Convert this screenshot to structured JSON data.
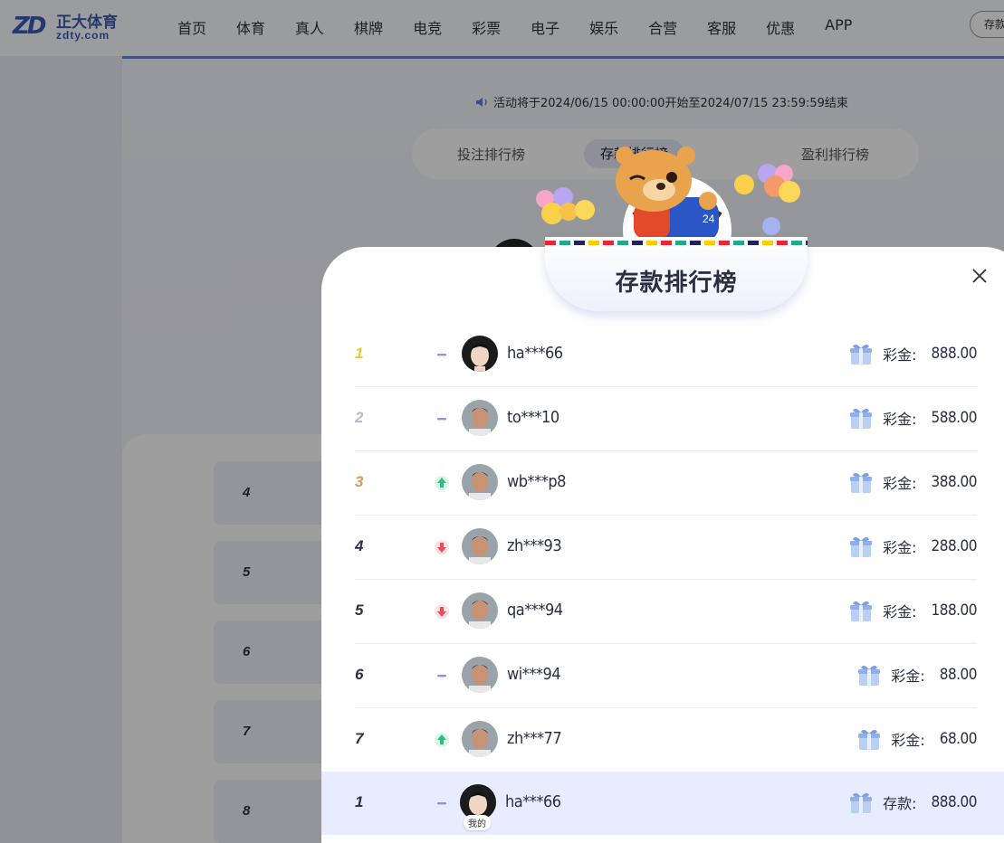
{
  "header": {
    "logo_mark": "ZD",
    "logo_cn": "正大体育",
    "logo_en": "zdty.com",
    "nav": [
      "首页",
      "体育",
      "真人",
      "棋牌",
      "电竞",
      "彩票",
      "电子",
      "娱乐",
      "合营",
      "客服",
      "优惠",
      "APP"
    ],
    "deposit_btn": "存款"
  },
  "page": {
    "notice": "活动将于2024/06/15 00:00:00开始至2024/07/15 23:59:59结束",
    "tabs": [
      "投注排行榜",
      "存款排行榜",
      "盈利排行榜"
    ],
    "active_tab": 1,
    "bg_ranks": [
      "4",
      "5",
      "6",
      "7",
      "8"
    ]
  },
  "modal": {
    "title": "存款排行榜",
    "rows": [
      {
        "rank": "1",
        "trend": "flat",
        "name": "ha***66",
        "label": "彩金:",
        "amount": "888.00",
        "avatar": "female"
      },
      {
        "rank": "2",
        "trend": "flat",
        "name": "to***10",
        "label": "彩金:",
        "amount": "588.00",
        "avatar": "male"
      },
      {
        "rank": "3",
        "trend": "up",
        "name": "wb***p8",
        "label": "彩金:",
        "amount": "388.00",
        "avatar": "male"
      },
      {
        "rank": "4",
        "trend": "down",
        "name": "zh***93",
        "label": "彩金:",
        "amount": "288.00",
        "avatar": "male"
      },
      {
        "rank": "5",
        "trend": "down",
        "name": "qa***94",
        "label": "彩金:",
        "amount": "188.00",
        "avatar": "male"
      },
      {
        "rank": "6",
        "trend": "flat",
        "name": "wi***94",
        "label": "彩金:",
        "amount": "88.00",
        "avatar": "male"
      },
      {
        "rank": "7",
        "trend": "up",
        "name": "zh***77",
        "label": "彩金:",
        "amount": "68.00",
        "avatar": "male"
      }
    ],
    "me": {
      "rank": "1",
      "trend": "flat",
      "name": "ha***66",
      "label": "存款:",
      "amount": "888.00",
      "tag": "我的",
      "avatar": "female"
    },
    "rank_colors": {
      "1": "#f2c230",
      "2": "#b4b8d8",
      "3": "#d99a5a",
      "default": "#2a2f44"
    },
    "trend_colors": {
      "up": "#2fbf7c",
      "down": "#ee4b5a",
      "flat": "#8b93e0"
    }
  }
}
